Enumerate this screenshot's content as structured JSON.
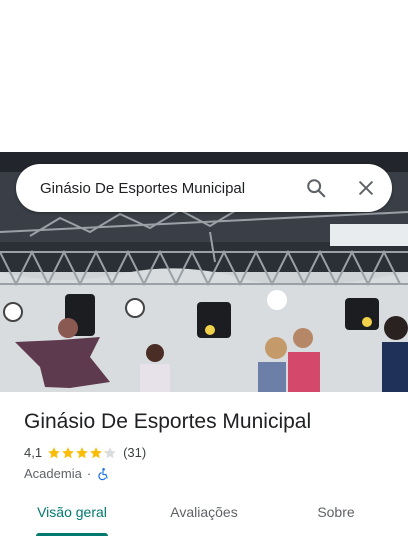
{
  "search": {
    "query": "Ginásio De Esportes Municipal",
    "search_icon": "search-icon",
    "close_icon": "close-icon"
  },
  "hero_photo": {
    "subject": "indoor gym stage with truss lighting and dancers"
  },
  "place": {
    "title": "Ginásio De Esportes Municipal",
    "rating": "4,1",
    "rating_value": 4.1,
    "rating_max": 5,
    "review_count": "(31)",
    "category": "Academia",
    "separator": "·",
    "accessibility_icon": "wheelchair-accessible-icon"
  },
  "tabs": [
    {
      "label": "Visão geral",
      "active": true
    },
    {
      "label": "Avaliações",
      "active": false
    },
    {
      "label": "Sobre",
      "active": false
    }
  ],
  "colors": {
    "accent": "#01796f",
    "star": "#fbbc04",
    "star_empty": "#dadce0",
    "accessibility": "#1a73e8"
  }
}
